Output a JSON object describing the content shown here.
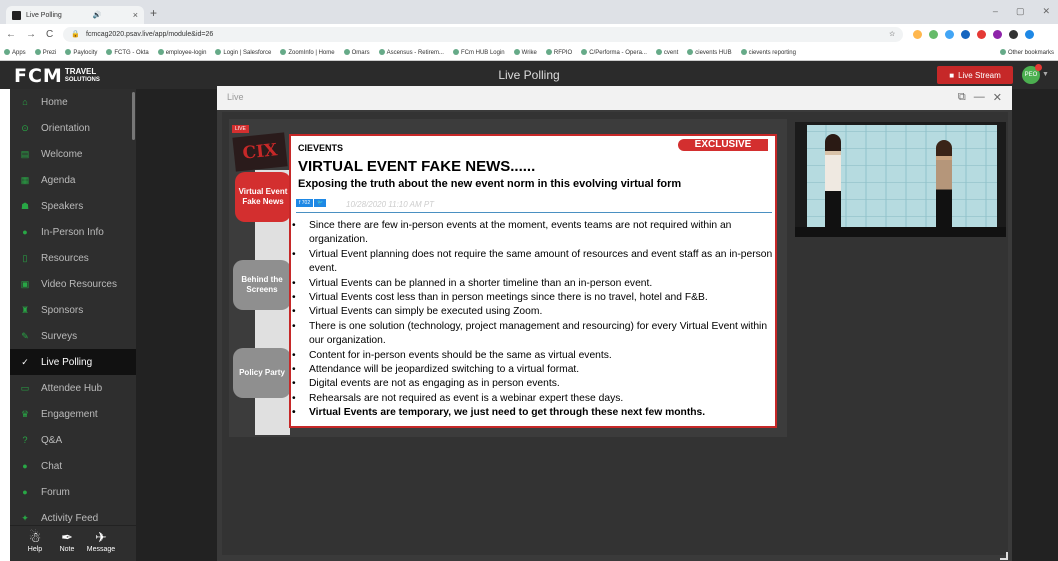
{
  "browser": {
    "tab_title": "Live Polling",
    "url": "fcmcag2020.psav.live/app/module&id=26",
    "bookmarks": [
      "Apps",
      "Prezi",
      "Paylocity",
      "FCTG - Okta",
      "employee-login",
      "Login | Salesforce",
      "ZoomInfo | Home",
      "Omars",
      "Ascensus - Retirem...",
      "FCm HUB Login",
      "Wrike",
      "RFPIO",
      "C/Performa - Opera...",
      "cvent",
      "cievents HUB",
      "cievents reporting",
      "Other bookmarks"
    ],
    "new_tab_symbol": "+",
    "window_controls": [
      "–",
      "▢",
      "✕"
    ]
  },
  "header": {
    "logo_fcm": "FCM",
    "logo_travel": "TRAVEL",
    "logo_solutions": "SOLUTIONS",
    "title": "Live Polling",
    "live_stream_label": "Live Stream",
    "avatar_initials": "PEO"
  },
  "sidebar": {
    "items": [
      {
        "label": "Home",
        "icon": "home-icon"
      },
      {
        "label": "Orientation",
        "icon": "compass-icon"
      },
      {
        "label": "Welcome",
        "icon": "document-icon"
      },
      {
        "label": "Agenda",
        "icon": "calendar-icon"
      },
      {
        "label": "Speakers",
        "icon": "users-icon"
      },
      {
        "label": "In-Person Info",
        "icon": "chat-icon"
      },
      {
        "label": "Resources",
        "icon": "file-icon"
      },
      {
        "label": "Video Resources",
        "icon": "video-icon"
      },
      {
        "label": "Sponsors",
        "icon": "trophy-icon"
      },
      {
        "label": "Surveys",
        "icon": "pencil-icon"
      },
      {
        "label": "Live Polling",
        "icon": "check-icon",
        "active": true
      },
      {
        "label": "Attendee Hub",
        "icon": "id-card-icon"
      },
      {
        "label": "Engagement",
        "icon": "crown-icon"
      },
      {
        "label": "Q&A",
        "icon": "question-icon"
      },
      {
        "label": "Chat",
        "icon": "chat-bubble-icon"
      },
      {
        "label": "Forum",
        "icon": "forum-icon"
      },
      {
        "label": "Activity Feed",
        "icon": "twitter-icon"
      }
    ],
    "footer": [
      {
        "label": "Help",
        "icon": "help-icon"
      },
      {
        "label": "Note",
        "icon": "feather-icon"
      },
      {
        "label": "Message",
        "icon": "paper-plane-icon"
      }
    ]
  },
  "panel": {
    "title": "Live",
    "controls": [
      "⧉",
      "—",
      "✕"
    ]
  },
  "video": {
    "live_badge": "LIVE",
    "brand": "CIX",
    "side_buttons": [
      "Virtual Event Fake News",
      "Behind the Screens",
      "Policy Party"
    ],
    "slide": {
      "exclusive": "EXCLUSIVE",
      "source": "CIEVENTS",
      "headline": "VIRTUAL EVENT FAKE NEWS......",
      "subheadline": "Exposing the truth about the new event norm in this evolving virtual form",
      "social": [
        "f 702",
        "🐦"
      ],
      "date": "10/28/2020 11:10 AM PT",
      "bullets": [
        "Since there are few in-person events at the moment, events teams are not required within an organization.",
        "Virtual Event planning does not require the same amount of resources and event staff as an in-person event.",
        "Virtual Events can be planned in a shorter timeline than an in-person event.",
        "Virtual Events cost less than in person meetings since there is no travel, hotel and F&B.",
        "Virtual Events can simply be executed using Zoom.",
        "There is one solution (technology, project management and resourcing) for every  Virtual Event within our organization.",
        "Content for in-person events should be the same as virtual events.",
        "Attendance will be jeopardized switching to a virtual format.",
        "Digital events are not as engaging as in person events.",
        "Rehearsals are not required as event is a webinar expert these days.",
        "Virtual Events are temporary, we just need to get through these next few months."
      ]
    }
  },
  "colors": {
    "accent_green": "#28a745",
    "live_red": "#c62828",
    "sidebar_bg": "#2e2e2e"
  }
}
